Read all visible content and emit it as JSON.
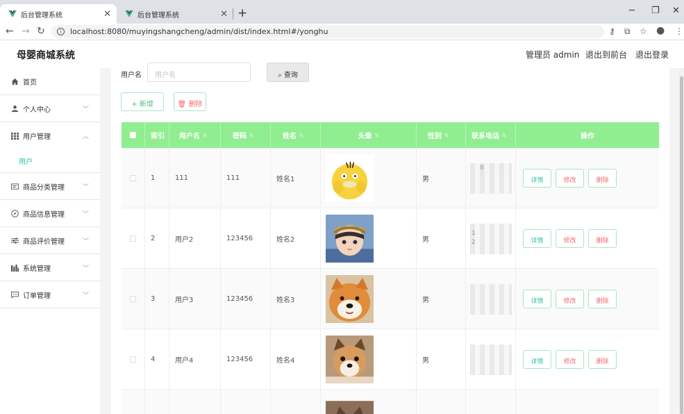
{
  "browser": {
    "tabs": [
      {
        "title": "后台管理系统",
        "active": true
      },
      {
        "title": "后台管理系统",
        "active": false
      }
    ],
    "url": "localhost:8080/muyingshangcheng/admin/dist/index.html#/yonghu"
  },
  "header": {
    "brand": "母婴商城系统",
    "admin_label": "管理员 admin",
    "to_front": "退出到前台",
    "logout": "退出登录"
  },
  "sidebar": {
    "items": [
      {
        "label": "首页",
        "icon": "home-icon"
      },
      {
        "label": "个人中心",
        "icon": "user-icon"
      },
      {
        "label": "用户管理",
        "icon": "grid-icon"
      },
      {
        "label": "商品分类管理",
        "icon": "card-icon"
      },
      {
        "label": "商品信息管理",
        "icon": "compass-icon"
      },
      {
        "label": "商品评价管理",
        "icon": "sliders-icon"
      },
      {
        "label": "系统管理",
        "icon": "chart-icon"
      },
      {
        "label": "订单管理",
        "icon": "chat-icon"
      }
    ],
    "sub_active": "用户"
  },
  "search": {
    "label": "用户名",
    "placeholder": "用户名",
    "button": "查询"
  },
  "actions": {
    "add": "新增",
    "delete": "删除"
  },
  "table": {
    "headers": [
      "索引",
      "用户名",
      "密码",
      "姓名",
      "头像",
      "性别",
      "联系电话",
      "操作"
    ],
    "rows": [
      {
        "index": "1",
        "username": "111",
        "password": "111",
        "name": "姓名1",
        "gender": "男",
        "phone": "8"
      },
      {
        "index": "2",
        "username": "用户2",
        "password": "123456",
        "name": "姓名2",
        "gender": "男",
        "phone": "1\n2"
      },
      {
        "index": "3",
        "username": "用户3",
        "password": "123456",
        "name": "姓名3",
        "gender": "男",
        "phone": ""
      },
      {
        "index": "4",
        "username": "用户4",
        "password": "123456",
        "name": "姓名4",
        "gender": "男",
        "phone": ""
      }
    ],
    "row_actions": {
      "detail": "详情",
      "edit": "修改",
      "remove": "删除"
    }
  },
  "colors": {
    "header_green": "#90ee90",
    "accent_teal": "#2fc1a4",
    "danger": "#f56c6c"
  }
}
